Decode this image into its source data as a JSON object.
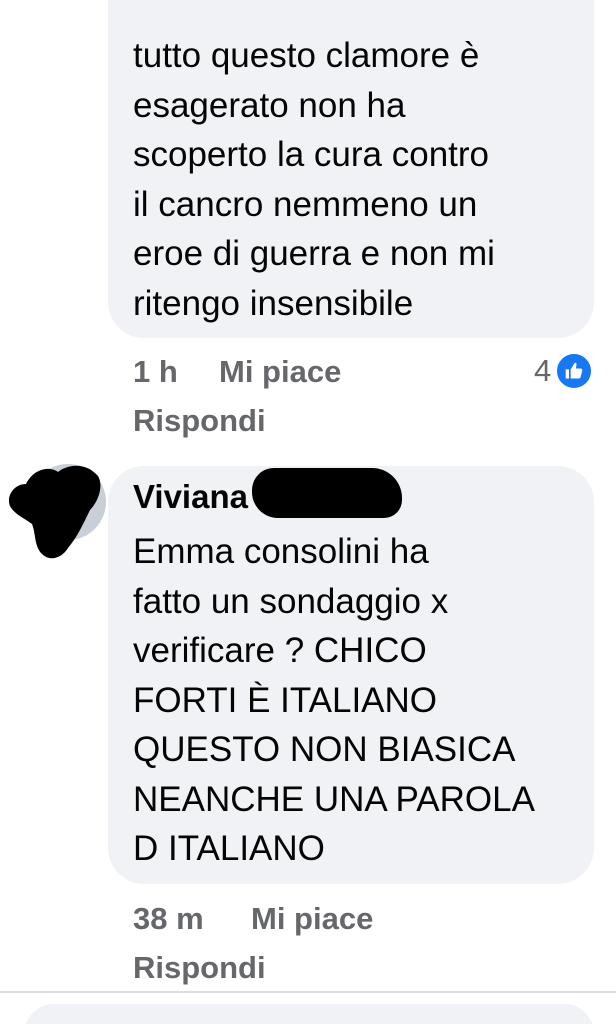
{
  "comments": [
    {
      "text": "tutto questo clamore è\nesagerato non ha\nscoperto la cura contro\nil cancro nemmeno un\neroe di guerra e non mi\nritengo insensibile",
      "time": "1 h",
      "like_label": "Mi piace",
      "reply_label": "Rispondi",
      "reaction_count": "4",
      "reaction_icon": "thumbs-up-icon"
    },
    {
      "author": "Viviana",
      "text": "Emma consolini  ha\nfatto un sondaggio  x\nverificare  ?  CHICO\nFORTI È  ITALIANO\nQUESTO NON BIASICA\nNEANCHE UNA PAROLA\nD ITALIANO",
      "time": "38 m",
      "like_label": "Mi piace",
      "reply_label": "Rispondi"
    }
  ],
  "colors": {
    "bubble": "#f0f2f5",
    "text": "#050505",
    "meta": "#65676b",
    "accent": "#1877f2"
  }
}
